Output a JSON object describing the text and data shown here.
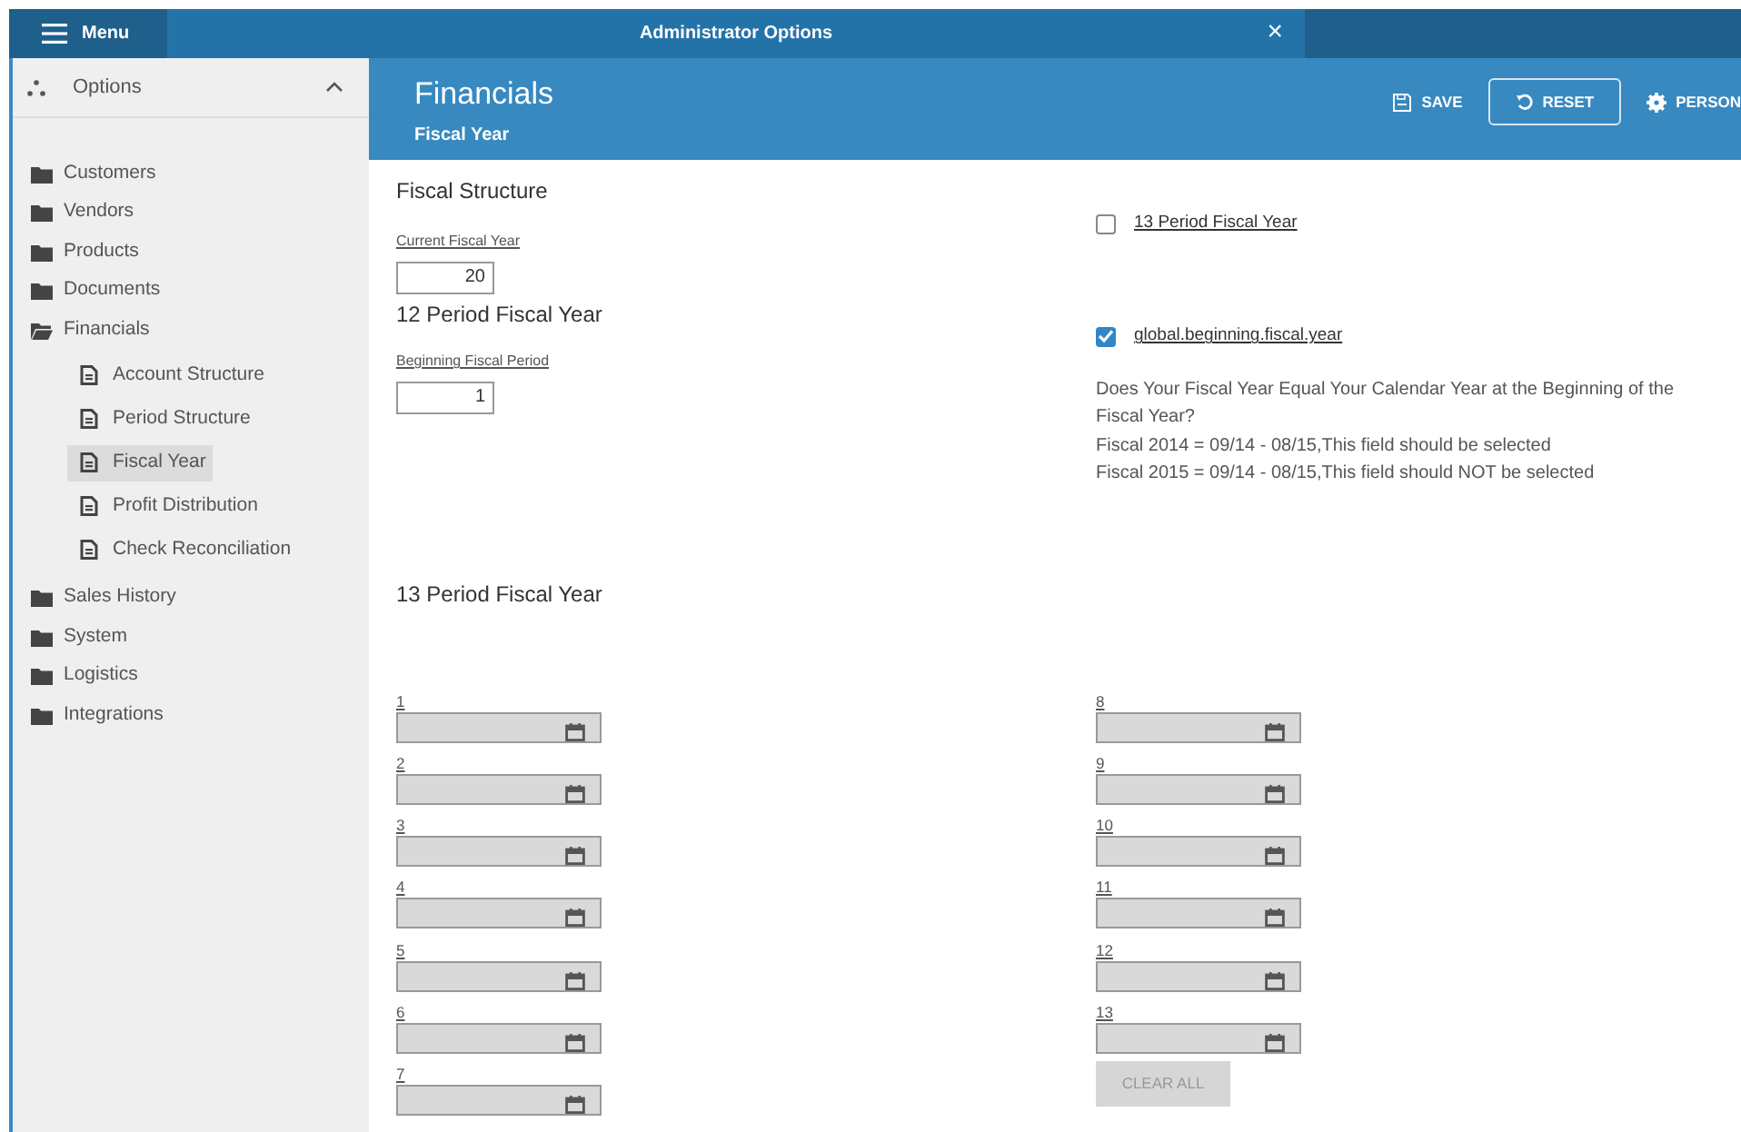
{
  "top_bar": {
    "menu_label": "Menu",
    "title": "Administrator Options",
    "close": "×"
  },
  "sidebar": {
    "header": "Options",
    "expanded": true,
    "items": [
      {
        "label": "Customers",
        "expanded": false
      },
      {
        "label": "Vendors",
        "expanded": false
      },
      {
        "label": "Products",
        "expanded": false
      },
      {
        "label": "Documents",
        "expanded": false
      },
      {
        "label": "Financials",
        "expanded": true,
        "children": [
          {
            "label": "Account Structure",
            "selected": false
          },
          {
            "label": "Period Structure",
            "selected": false
          },
          {
            "label": "Fiscal Year",
            "selected": true
          },
          {
            "label": "Profit Distribution",
            "selected": false
          },
          {
            "label": "Check Reconciliation",
            "selected": false
          }
        ]
      },
      {
        "label": "Sales History",
        "expanded": false
      },
      {
        "label": "System",
        "expanded": false
      },
      {
        "label": "Logistics",
        "expanded": false
      },
      {
        "label": "Integrations",
        "expanded": false
      }
    ]
  },
  "header": {
    "title": "Financials",
    "subtitle": "Fiscal Year",
    "actions": [
      {
        "kind": "save",
        "label": "SAVE"
      },
      {
        "kind": "reset",
        "label": "RESET"
      },
      {
        "kind": "personalize",
        "label": "PERSON"
      }
    ]
  },
  "form": {
    "section_title": "Fiscal Structure",
    "current_fiscal_year": {
      "label": "Current Fiscal Year",
      "value": "20"
    },
    "twelve_period_title": "12 Period Fiscal Year",
    "beginning_fiscal_period": {
      "label": "Beginning Fiscal Period",
      "value": "1"
    },
    "checkboxes": [
      {
        "label": "13 Period Fiscal Year",
        "checked": false
      },
      {
        "label": "global.beginning.fiscal.year",
        "checked": true
      }
    ],
    "description": [
      "Does Your Fiscal Year Equal Your Calendar Year at the Beginning of the",
      "Fiscal Year?",
      "Fiscal 2014 = 09/14 - 08/15,This field should be selected",
      "Fiscal 2015 = 09/14 - 08/15,This field should NOT be selected"
    ],
    "thirteen_period_title": "13 Period Fiscal Year",
    "periods": [
      {
        "label": "1",
        "disabled": true
      },
      {
        "label": "2",
        "disabled": true
      },
      {
        "label": "3",
        "disabled": true
      },
      {
        "label": "4",
        "disabled": true
      },
      {
        "label": "5",
        "disabled": true
      },
      {
        "label": "6",
        "disabled": true
      },
      {
        "label": "7",
        "disabled": true
      },
      {
        "label": "8",
        "disabled": true
      },
      {
        "label": "9",
        "disabled": true
      },
      {
        "label": "10",
        "disabled": true
      },
      {
        "label": "11",
        "disabled": true
      },
      {
        "label": "12",
        "disabled": true
      },
      {
        "label": "13",
        "disabled": true
      }
    ],
    "clear_all": {
      "label": "CLEAR ALL",
      "disabled": true
    }
  }
}
